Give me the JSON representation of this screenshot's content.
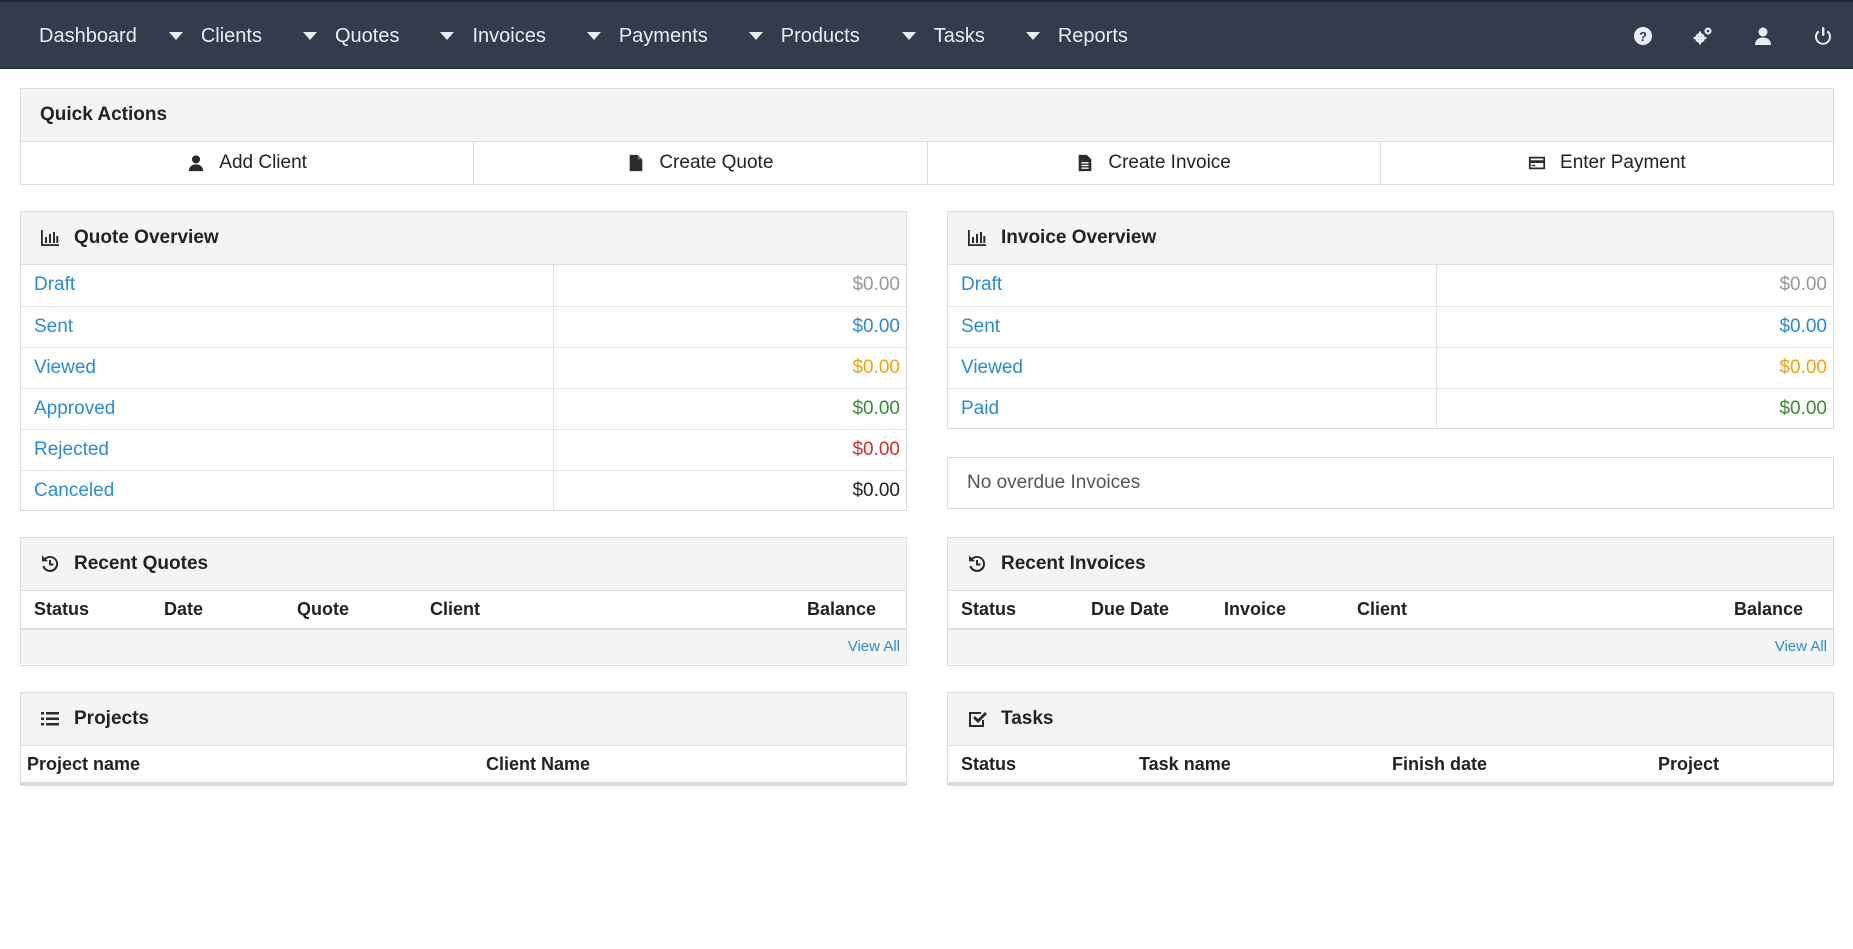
{
  "nav": {
    "items": [
      {
        "label": "Dashboard"
      },
      {
        "label": "Clients"
      },
      {
        "label": "Quotes"
      },
      {
        "label": "Invoices"
      },
      {
        "label": "Payments"
      },
      {
        "label": "Products"
      },
      {
        "label": "Tasks"
      },
      {
        "label": "Reports"
      }
    ],
    "icons": [
      "help-icon",
      "settings-icon",
      "user-icon",
      "power-icon"
    ]
  },
  "quick_actions": {
    "title": "Quick Actions",
    "buttons": [
      {
        "label": "Add Client",
        "icon": "user-icon"
      },
      {
        "label": "Create Quote",
        "icon": "file-icon"
      },
      {
        "label": "Create Invoice",
        "icon": "file-text-icon"
      },
      {
        "label": "Enter Payment",
        "icon": "credit-card-icon"
      }
    ]
  },
  "quote_overview": {
    "title": "Quote Overview",
    "rows": [
      {
        "label": "Draft",
        "amount": "$0.00",
        "color": "#999999"
      },
      {
        "label": "Sent",
        "amount": "$0.00",
        "color": "#2a8ad4"
      },
      {
        "label": "Viewed",
        "amount": "$0.00",
        "color": "#f0a30a"
      },
      {
        "label": "Approved",
        "amount": "$0.00",
        "color": "#3a8a2f"
      },
      {
        "label": "Rejected",
        "amount": "$0.00",
        "color": "#c9302c"
      },
      {
        "label": "Canceled",
        "amount": "$0.00",
        "color": "#222222"
      }
    ]
  },
  "invoice_overview": {
    "title": "Invoice Overview",
    "rows": [
      {
        "label": "Draft",
        "amount": "$0.00",
        "color": "#999999"
      },
      {
        "label": "Sent",
        "amount": "$0.00",
        "color": "#2a8ad4"
      },
      {
        "label": "Viewed",
        "amount": "$0.00",
        "color": "#f0a30a"
      },
      {
        "label": "Paid",
        "amount": "$0.00",
        "color": "#3a8a2f"
      }
    ],
    "notice": "No overdue Invoices"
  },
  "recent_quotes": {
    "title": "Recent Quotes",
    "columns": [
      "Status",
      "Date",
      "Quote",
      "Client",
      "Balance"
    ],
    "view_all": "View All"
  },
  "recent_invoices": {
    "title": "Recent Invoices",
    "columns": [
      "Status",
      "Due Date",
      "Invoice",
      "Client",
      "Balance"
    ],
    "view_all": "View All"
  },
  "projects": {
    "title": "Projects",
    "columns": [
      "Project name",
      "Client Name"
    ]
  },
  "tasks": {
    "title": "Tasks",
    "columns": [
      "Status",
      "Task name",
      "Finish date",
      "Project"
    ]
  },
  "colors": {
    "navbar": "#333c4c",
    "link": "#2a8ad4",
    "panel_heading": "#f4f4f4"
  }
}
